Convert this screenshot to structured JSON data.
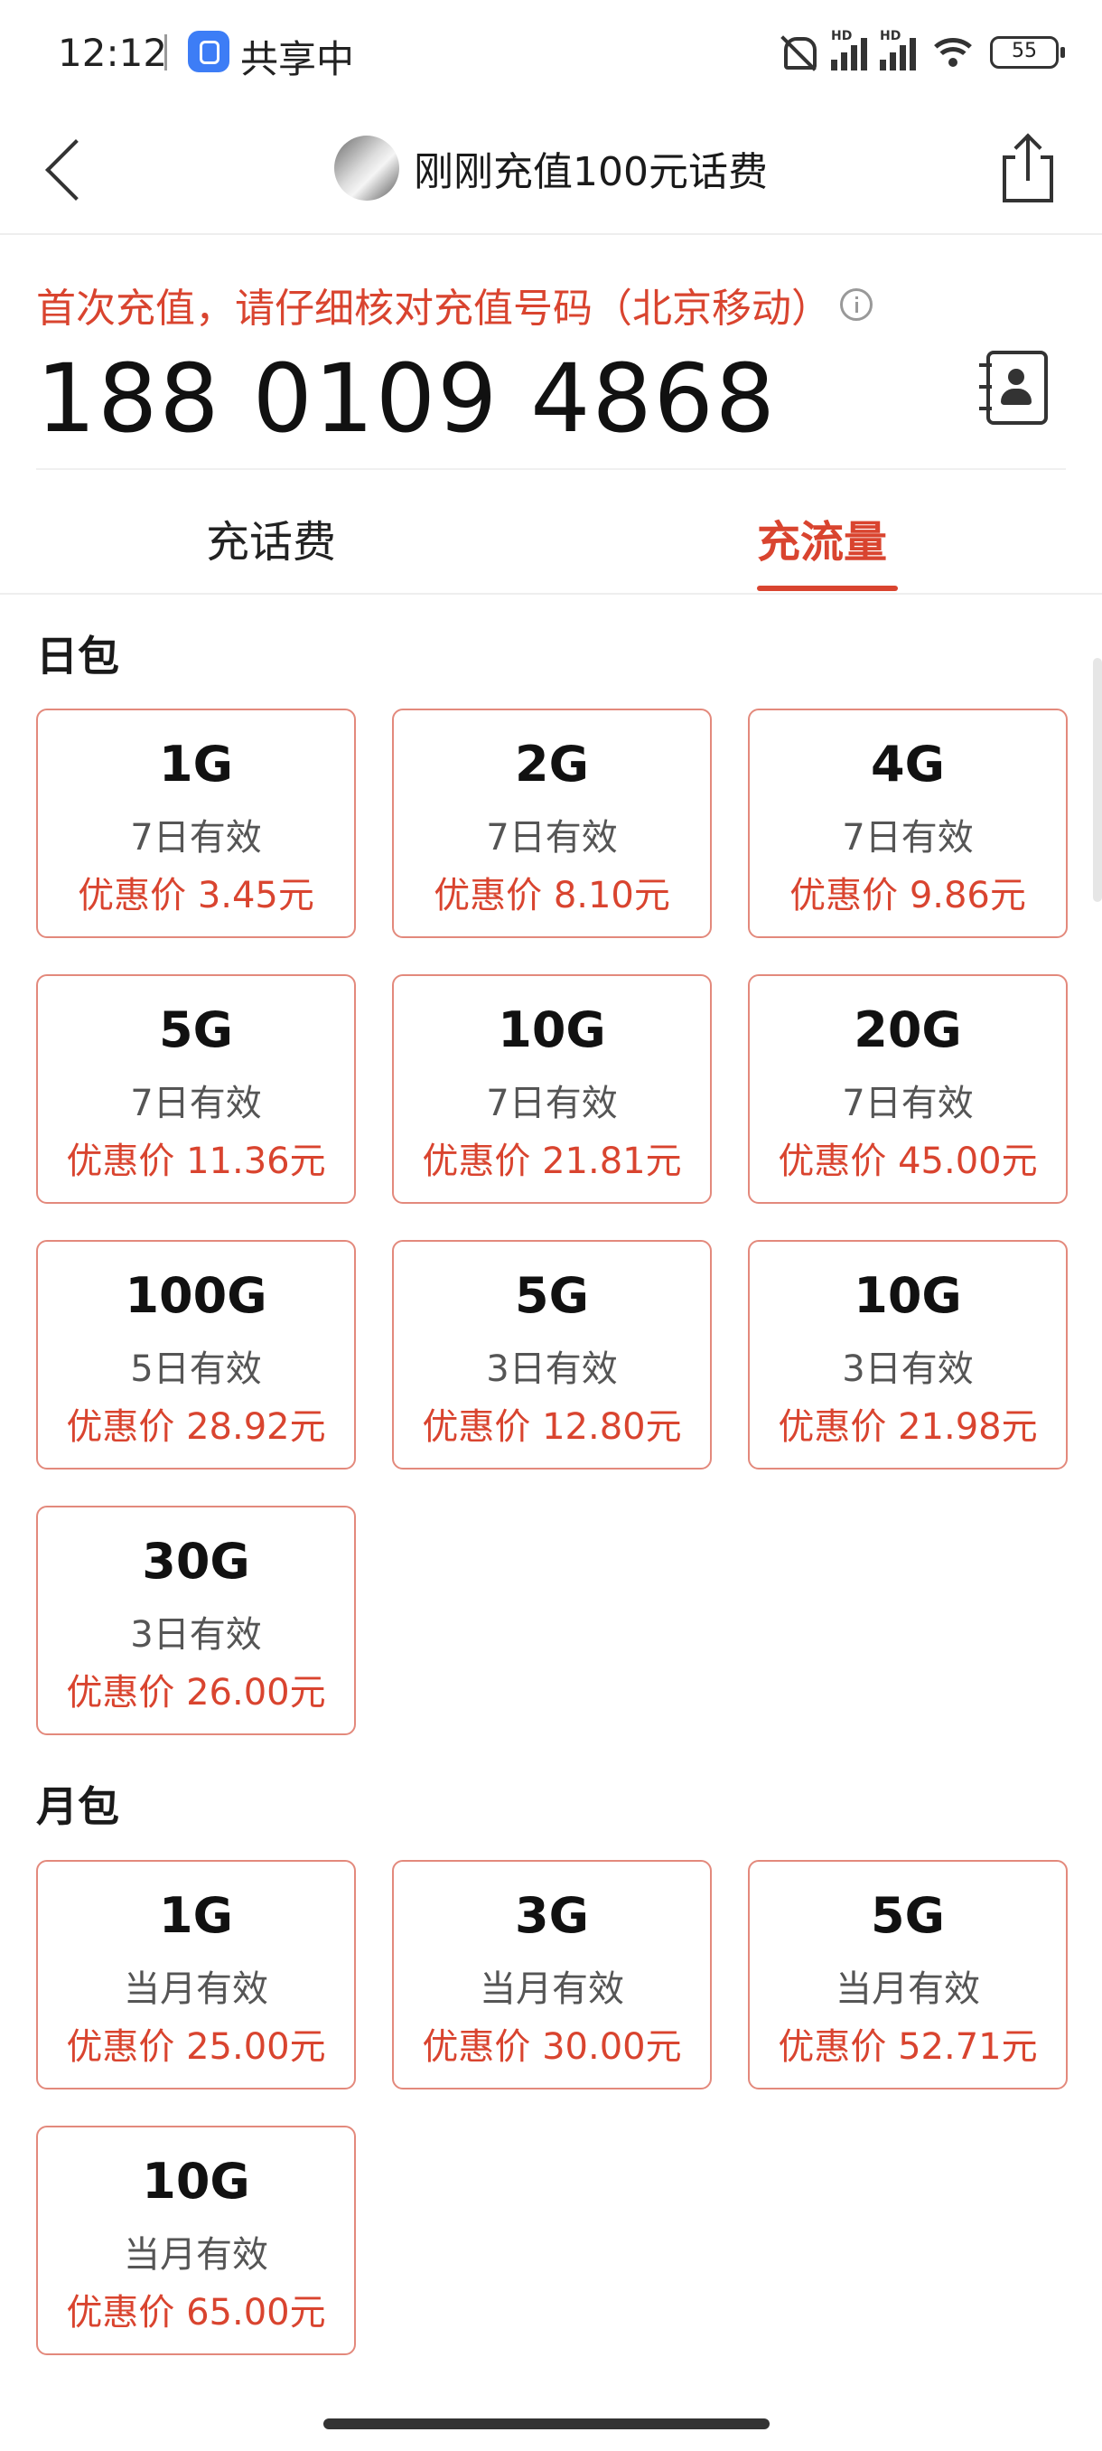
{
  "status_bar": {
    "time": "12:12",
    "sharing": "共享中",
    "battery": "55",
    "signal_label": "HD"
  },
  "header": {
    "title": "刚刚充值100元话费"
  },
  "recharge": {
    "notice": "首次充值，请仔细核对充值号码（北京移动）",
    "phone_number": "188 0109 4868"
  },
  "tabs": {
    "bill": "充话费",
    "data": "充流量",
    "active": "data"
  },
  "sections": [
    {
      "title": "日包",
      "packages": [
        {
          "size": "1G",
          "validity": "7日有效",
          "price": "优惠价 3.45元"
        },
        {
          "size": "2G",
          "validity": "7日有效",
          "price": "优惠价 8.10元"
        },
        {
          "size": "4G",
          "validity": "7日有效",
          "price": "优惠价 9.86元"
        },
        {
          "size": "5G",
          "validity": "7日有效",
          "price": "优惠价 11.36元"
        },
        {
          "size": "10G",
          "validity": "7日有效",
          "price": "优惠价 21.81元"
        },
        {
          "size": "20G",
          "validity": "7日有效",
          "price": "优惠价 45.00元"
        },
        {
          "size": "100G",
          "validity": "5日有效",
          "price": "优惠价 28.92元"
        },
        {
          "size": "5G",
          "validity": "3日有效",
          "price": "优惠价 12.80元"
        },
        {
          "size": "10G",
          "validity": "3日有效",
          "price": "优惠价 21.98元"
        },
        {
          "size": "30G",
          "validity": "3日有效",
          "price": "优惠价 26.00元"
        }
      ]
    },
    {
      "title": "月包",
      "packages": [
        {
          "size": "1G",
          "validity": "当月有效",
          "price": "优惠价 25.00元"
        },
        {
          "size": "3G",
          "validity": "当月有效",
          "price": "优惠价 30.00元"
        },
        {
          "size": "5G",
          "validity": "当月有效",
          "price": "优惠价 52.71元"
        },
        {
          "size": "10G",
          "validity": "当月有效",
          "price": "优惠价 65.00元"
        }
      ]
    }
  ],
  "colors": {
    "accent": "#d9442f",
    "card_border": "#e3897c"
  }
}
